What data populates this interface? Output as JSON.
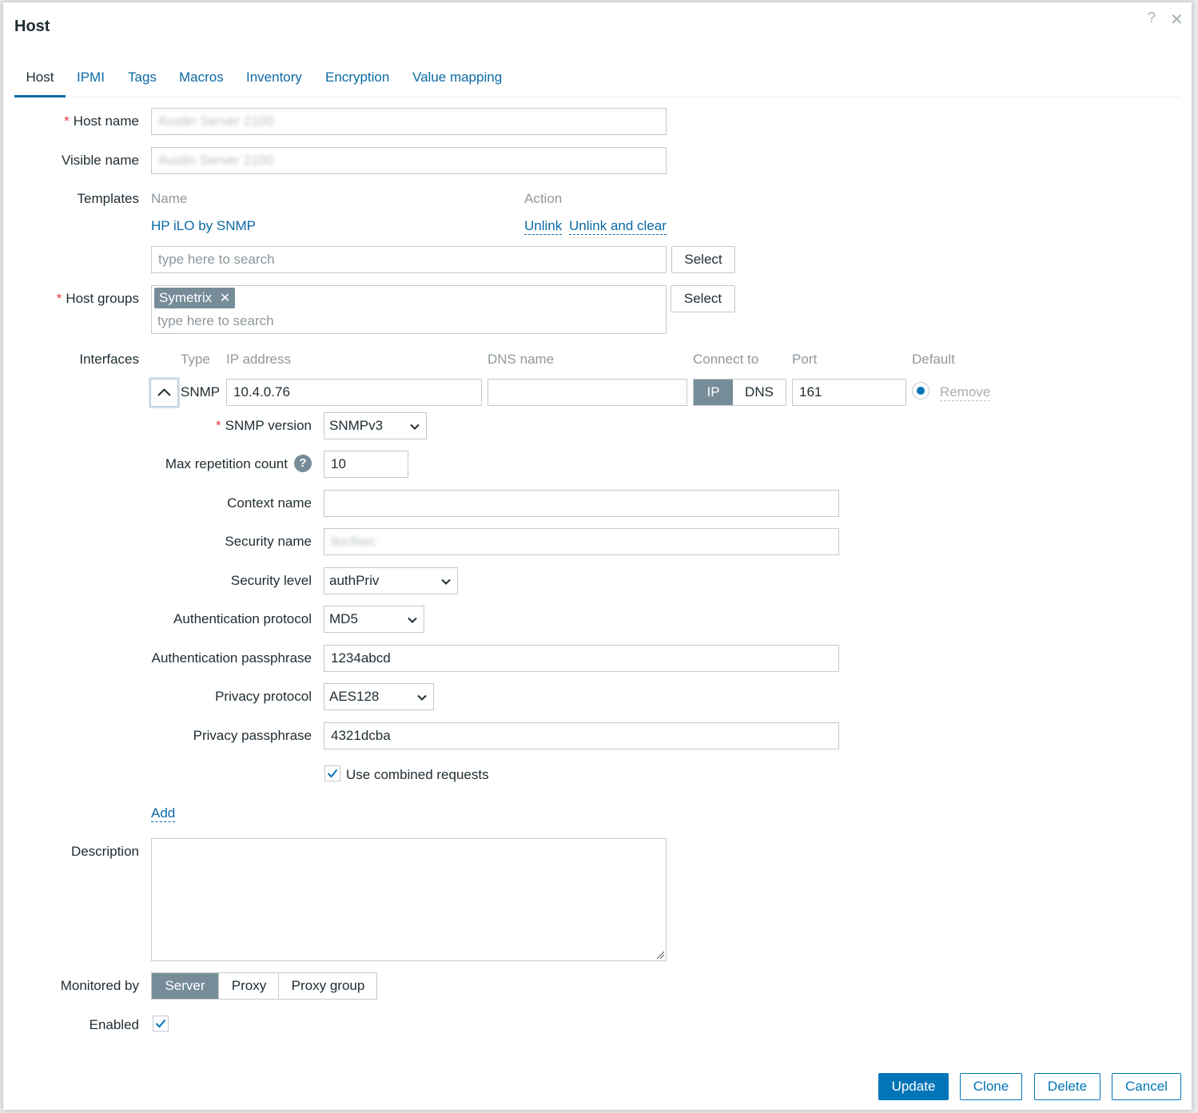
{
  "dialog": {
    "title": "Host",
    "help_icon": "?",
    "close_icon": "✕"
  },
  "tabs": [
    "Host",
    "IPMI",
    "Tags",
    "Macros",
    "Inventory",
    "Encryption",
    "Value mapping"
  ],
  "form": {
    "host_name": {
      "label": "Host name",
      "value": "Austin Server 2100"
    },
    "visible_name": {
      "label": "Visible name",
      "value": "Austin Server 2100"
    },
    "templates": {
      "label": "Templates",
      "col_name": "Name",
      "col_action": "Action",
      "item": "HP iLO by SNMP",
      "unlink": "Unlink",
      "unlink_clear": "Unlink and clear",
      "placeholder": "type here to search",
      "select": "Select"
    },
    "host_groups": {
      "label": "Host groups",
      "tag": "Symetrix",
      "placeholder": "type here to search",
      "select": "Select"
    },
    "interfaces": {
      "label": "Interfaces",
      "headers": {
        "type": "Type",
        "ip": "IP address",
        "dns": "DNS name",
        "connect": "Connect to",
        "port": "Port",
        "default": "Default"
      },
      "row": {
        "type": "SNMP",
        "ip": "10.4.0.76",
        "dns": "",
        "connect_ip": "IP",
        "connect_dns": "DNS",
        "port": "161",
        "remove": "Remove"
      },
      "add": "Add"
    },
    "snmp": {
      "version_label": "SNMP version",
      "version": "SNMPv3",
      "max_rep_label": "Max repetition count",
      "max_rep": "10",
      "context_label": "Context name",
      "context": "",
      "security_name_label": "Security name",
      "security_name": "ilocfsec",
      "security_level_label": "Security level",
      "security_level": "authPriv",
      "auth_proto_label": "Authentication protocol",
      "auth_proto": "MD5",
      "auth_pass_label": "Authentication passphrase",
      "auth_pass": "1234abcd",
      "priv_proto_label": "Privacy protocol",
      "priv_proto": "AES128",
      "priv_pass_label": "Privacy passphrase",
      "priv_pass": "4321dcba",
      "combined_label": "Use combined requests"
    },
    "description": {
      "label": "Description",
      "value": ""
    },
    "monitored_by": {
      "label": "Monitored by",
      "options": [
        "Server",
        "Proxy",
        "Proxy group"
      ]
    },
    "enabled": {
      "label": "Enabled"
    }
  },
  "footer": {
    "update": "Update",
    "clone": "Clone",
    "delete": "Delete",
    "cancel": "Cancel"
  },
  "colors": {
    "accent": "#0275b8",
    "link": "#0a6aa5",
    "segment_on": "#768d99",
    "required": "#e33734"
  }
}
